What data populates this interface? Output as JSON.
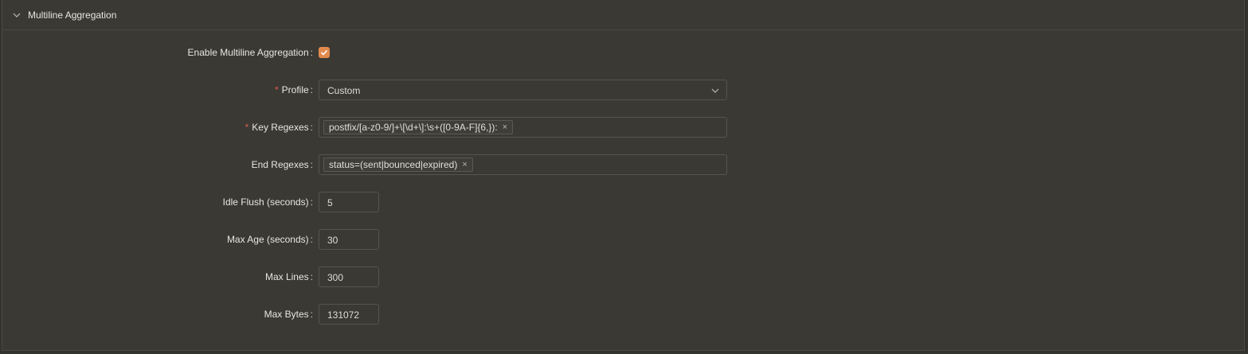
{
  "section": {
    "title": "Multiline Aggregation"
  },
  "fields": {
    "enable": {
      "label": "Enable Multiline Aggregation",
      "checked": true
    },
    "profile": {
      "label": "Profile",
      "required": true,
      "value": "Custom"
    },
    "key_regexes": {
      "label": "Key Regexes",
      "required": true,
      "tags": [
        "postfix/[a-z0-9/]+\\[\\d+\\]:\\s+([0-9A-F]{6,}):"
      ]
    },
    "end_regexes": {
      "label": "End Regexes",
      "required": false,
      "tags": [
        "status=(sent|bounced|expired)"
      ]
    },
    "idle_flush": {
      "label": "Idle Flush (seconds)",
      "value": "5"
    },
    "max_age": {
      "label": "Max Age (seconds)",
      "value": "30"
    },
    "max_lines": {
      "label": "Max Lines",
      "value": "300"
    },
    "max_bytes": {
      "label": "Max Bytes",
      "value": "131072"
    }
  },
  "glyphs": {
    "required_mark": "*",
    "colon": ":",
    "tag_close": "×"
  },
  "colors": {
    "accent": "#e08a4e",
    "required": "#e05a4f",
    "background": "#3a3934"
  }
}
